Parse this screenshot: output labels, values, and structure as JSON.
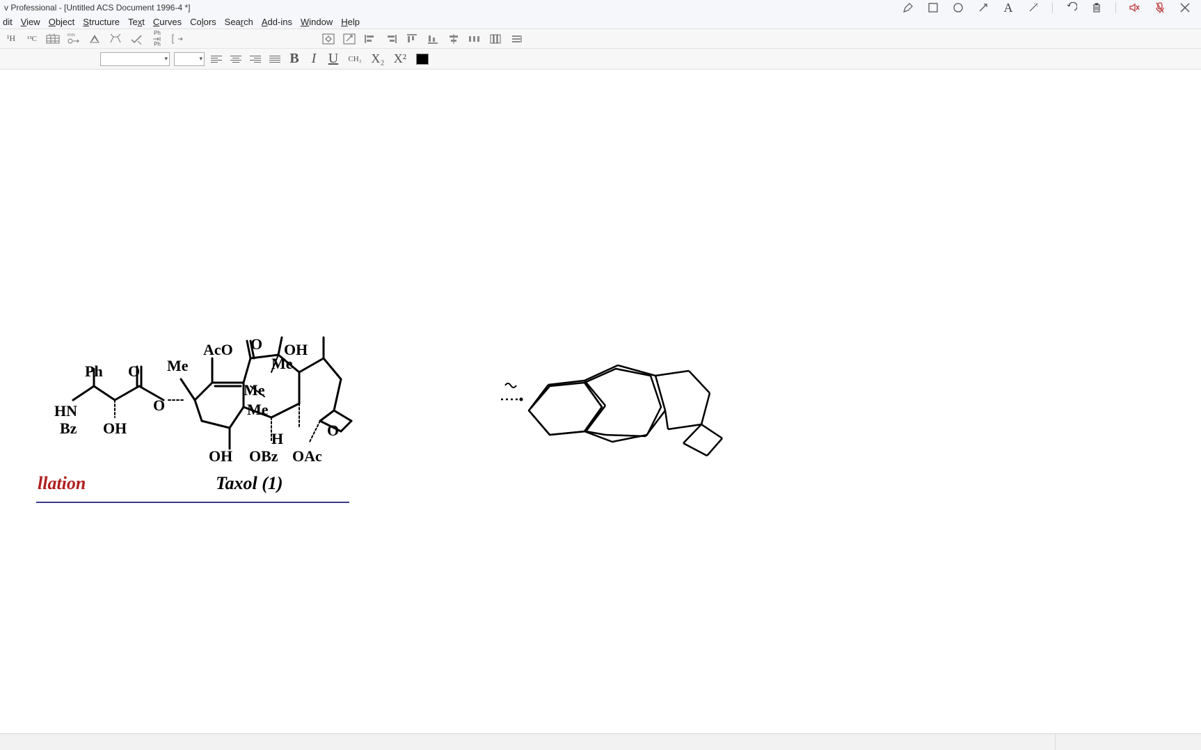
{
  "title": "v Professional - [Untitled ACS Document 1996-4 *]",
  "menu": {
    "edit": "dit",
    "view": "View",
    "object": "Object",
    "structure": "Structure",
    "text": "Text",
    "curves": "Curves",
    "colors": "Colors",
    "search": "Search",
    "addins": "Add-ins",
    "window": "Window",
    "help": "Help"
  },
  "toolbar1": {
    "h1": "¹H",
    "c13": "¹³C",
    "ab": "A→B",
    "rxn": "RXN",
    "ph": "Ph"
  },
  "text_toolbar": {
    "bold": "B",
    "italic": "I",
    "underline": "U",
    "ch2": "CH₂",
    "sub": "X₂",
    "sup": "X²"
  },
  "chem": {
    "AcO": "AcO",
    "O_top": "O",
    "OH_top": "OH",
    "Me1": "Me",
    "Me2": "Me",
    "Me3": "Me",
    "Me4": "Me",
    "Ph": "Ph",
    "O_sc": "O",
    "HN": "HN",
    "Bz": "Bz",
    "OH_sc": "OH",
    "O_dots": "O",
    "H": "H",
    "OH_bot": "OH",
    "OBz": "OBz",
    "OAc": "OAc",
    "O_ring": "O",
    "ilation": "llation",
    "taxol": "Taxol (1)"
  }
}
